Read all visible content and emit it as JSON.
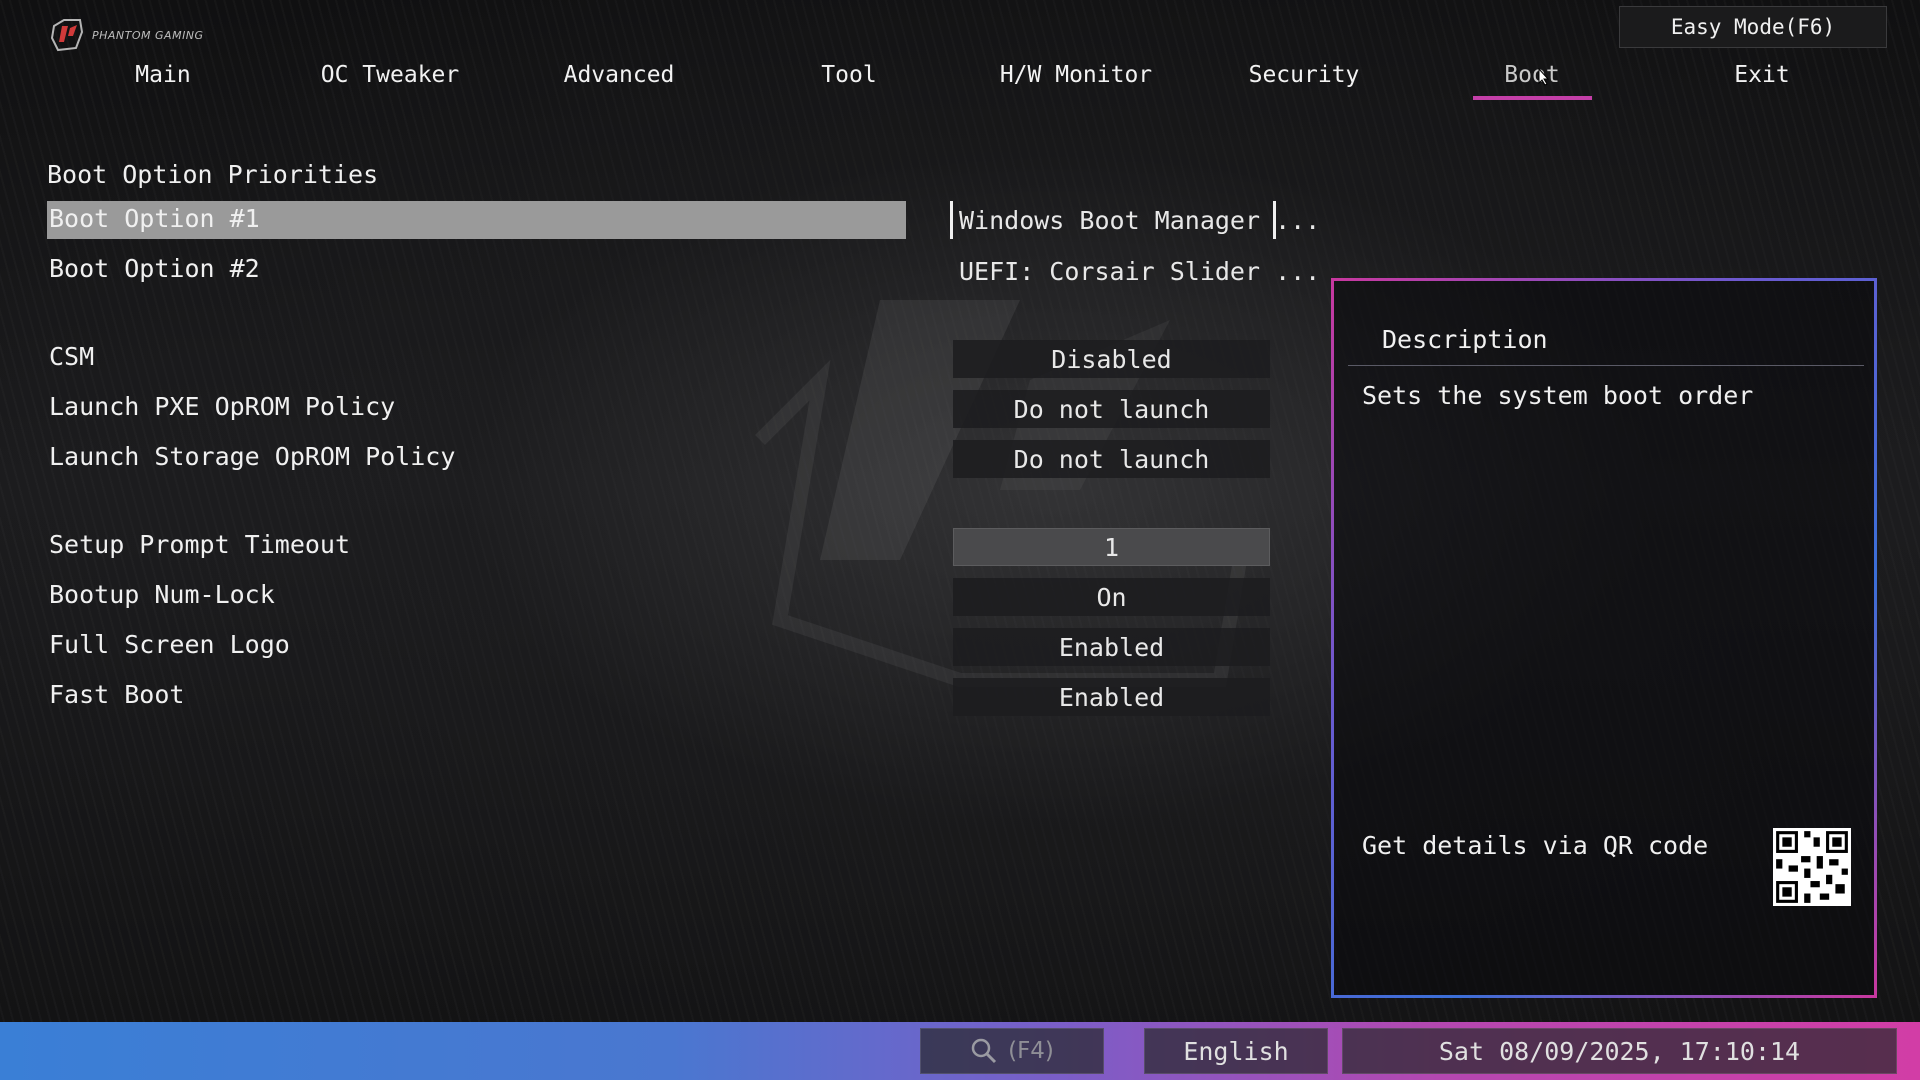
{
  "brand": {
    "logo_text": "PHANTOM GAMING"
  },
  "easy_mode_label": "Easy Mode(F6)",
  "tabs": [
    {
      "label": "Main"
    },
    {
      "label": "OC Tweaker"
    },
    {
      "label": "Advanced"
    },
    {
      "label": "Tool"
    },
    {
      "label": "H/W Monitor"
    },
    {
      "label": "Security"
    },
    {
      "label": "Boot",
      "active": true
    },
    {
      "label": "Exit"
    }
  ],
  "boot": {
    "section_title": "Boot Option Priorities",
    "options": [
      {
        "label": "Boot Option #1",
        "value": "Windows Boot Manager ..."
      },
      {
        "label": "Boot Option #2",
        "value": "UEFI: Corsair Slider ..."
      }
    ],
    "settings": [
      {
        "label": "CSM",
        "value": "Disabled"
      },
      {
        "label": "Launch PXE OpROM Policy",
        "value": "Do not launch"
      },
      {
        "label": "Launch Storage OpROM Policy",
        "value": "Do not launch"
      },
      {
        "label": "Setup Prompt Timeout",
        "value": "1"
      },
      {
        "label": "Bootup Num-Lock",
        "value": "On"
      },
      {
        "label": "Full Screen Logo",
        "value": "Enabled"
      },
      {
        "label": "Fast Boot",
        "value": "Enabled"
      }
    ]
  },
  "description": {
    "title": "Description",
    "text": "Sets the system boot order",
    "qr_label": "Get details via QR code"
  },
  "bottom_bar": {
    "search_shortcut": "(F4)",
    "language": "English",
    "datetime": "Sat 08/09/2025, 17:10:14"
  },
  "colors": {
    "accent": "#c43fa8",
    "bottom_left": "#3a7fd6",
    "bottom_right": "#d23da6"
  }
}
